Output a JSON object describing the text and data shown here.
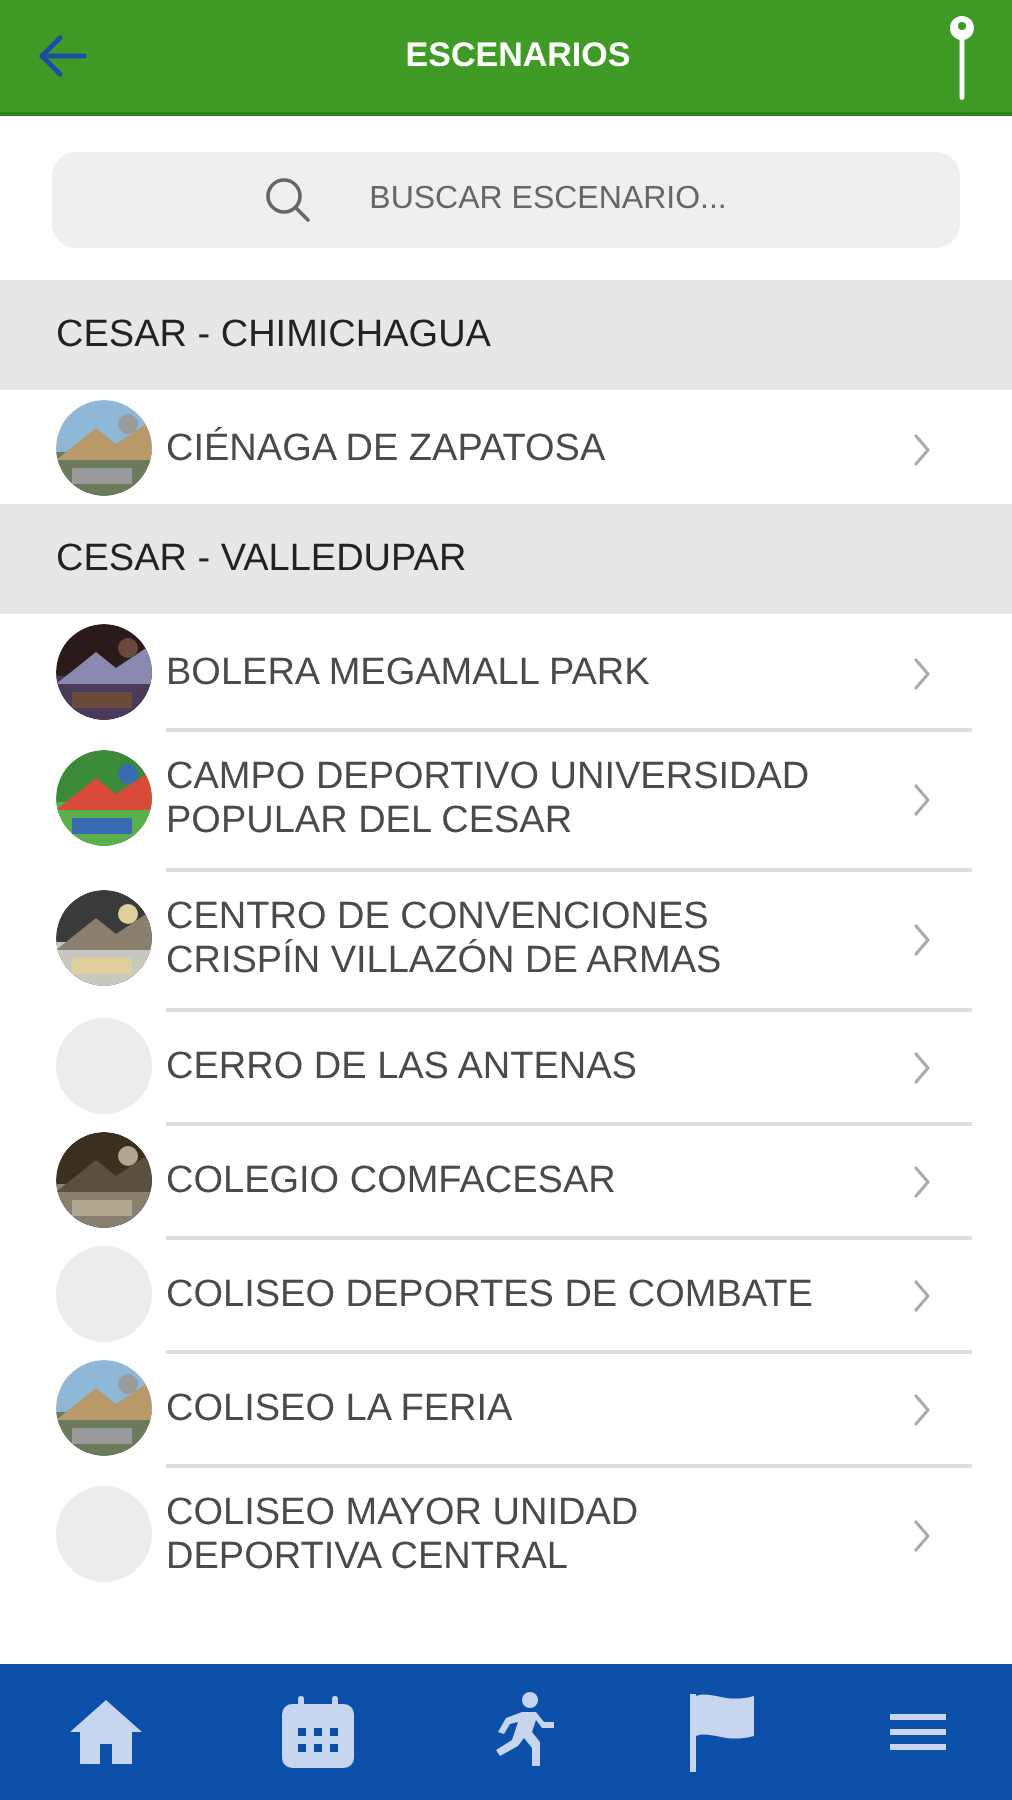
{
  "header": {
    "title": "ESCENARIOS"
  },
  "search": {
    "placeholder": "BUSCAR ESCENARIO..."
  },
  "sections": [
    {
      "title": "CESAR - CHIMICHAGUA",
      "items": [
        {
          "name": "CIÉNAGA DE ZAPATOSA"
        }
      ]
    },
    {
      "title": "CESAR - VALLEDUPAR",
      "items": [
        {
          "name": "BOLERA MEGAMALL PARK"
        },
        {
          "name": "CAMPO DEPORTIVO UNIVERSIDAD POPULAR DEL CESAR"
        },
        {
          "name": "CENTRO DE CONVENCIONES CRISPÍN VILLAZÓN DE ARMAS"
        },
        {
          "name": "CERRO DE LAS ANTENAS",
          "kind": "blank"
        },
        {
          "name": "COLEGIO COMFACESAR"
        },
        {
          "name": "COLISEO DEPORTES DE COMBATE",
          "kind": "blank"
        },
        {
          "name": "COLISEO LA FERIA"
        },
        {
          "name": "COLISEO MAYOR UNIDAD DEPORTIVA CENTRAL",
          "kind": "blank"
        }
      ]
    }
  ]
}
